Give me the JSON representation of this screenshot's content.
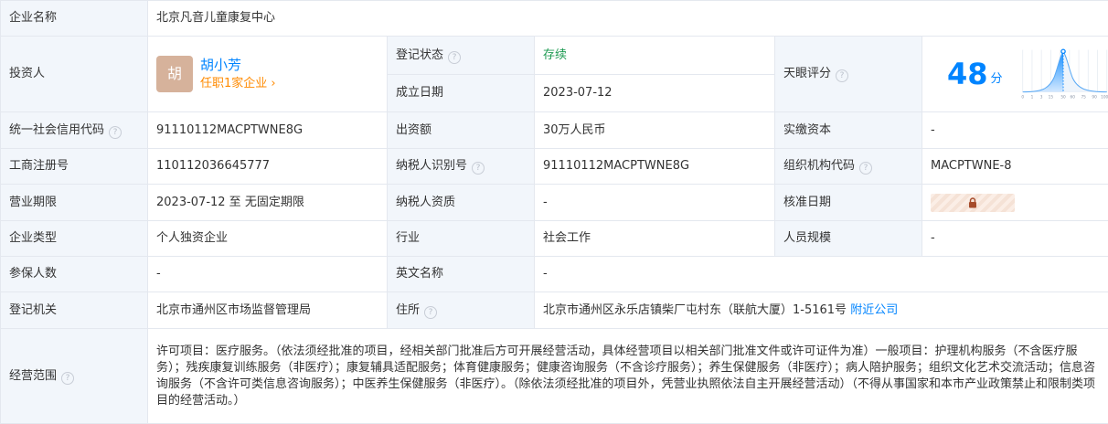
{
  "company_name": {
    "label": "企业名称",
    "value": "北京凡音儿童康复中心"
  },
  "investor": {
    "label": "投资人",
    "avatar_char": "胡",
    "name": "胡小芳",
    "role": "任职1家企业",
    "role_arrow": "›"
  },
  "reg_status": {
    "label": "登记状态",
    "value": "存续"
  },
  "found_date": {
    "label": "成立日期",
    "value": "2023-07-12"
  },
  "tianyan_score": {
    "label": "天眼评分",
    "score": "48",
    "unit": "分",
    "axis_ticks": [
      "0",
      "1",
      "3",
      "15",
      "50",
      "60",
      "75",
      "90",
      "100"
    ],
    "marker_value": 50
  },
  "credit_code": {
    "label": "统一社会信用代码",
    "value": "91110112MACPTWNE8G"
  },
  "capital": {
    "label": "出资额",
    "value": "30万人民币"
  },
  "paid_capital": {
    "label": "实缴资本",
    "value": "-"
  },
  "biz_reg_no": {
    "label": "工商注册号",
    "value": "110112036645777"
  },
  "taxpayer_id": {
    "label": "纳税人识别号",
    "value": "91110112MACPTWNE8G"
  },
  "org_code": {
    "label": "组织机构代码",
    "value": "MACPTWNE-8"
  },
  "biz_term": {
    "label": "营业期限",
    "value": "2023-07-12 至 无固定期限"
  },
  "taxpayer_qual": {
    "label": "纳税人资质",
    "value": "-"
  },
  "approve_date": {
    "label": "核准日期"
  },
  "company_type": {
    "label": "企业类型",
    "value": "个人独资企业"
  },
  "industry": {
    "label": "行业",
    "value": "社会工作"
  },
  "staff_size": {
    "label": "人员规模",
    "value": "-"
  },
  "insured": {
    "label": "参保人数",
    "value": "-"
  },
  "english_name": {
    "label": "英文名称",
    "value": "-"
  },
  "reg_authority": {
    "label": "登记机关",
    "value": "北京市通州区市场监督管理局"
  },
  "address": {
    "label": "住所",
    "value": "北京市通州区永乐店镇柴厂屯村东（联航大厦）1-5161号",
    "nearby": "附近公司"
  },
  "scope": {
    "label": "经营范围",
    "value": "许可项目：医疗服务。（依法须经批准的项目，经相关部门批准后方可开展经营活动，具体经营项目以相关部门批准文件或许可证件为准）一般项目：护理机构服务（不含医疗服务）；残疾康复训练服务（非医疗）；康复辅具适配服务；体育健康服务；健康咨询服务（不含诊疗服务）；养生保健服务（非医疗）；病人陪护服务；组织文化艺术交流活动；信息咨询服务（不含许可类信息咨询服务）；中医养生保健服务（非医疗）。（除依法须经批准的项目外，凭营业执照依法自主开展经营活动）（不得从事国家和本市产业政策禁止和限制类项目的经营活动。）"
  },
  "colors": {
    "label_bg": "#f2f6fb",
    "border": "#e4e8ef",
    "link": "#0084ff",
    "status_green": "#1f9b53",
    "accent_orange": "#ff8a00"
  },
  "icons": {
    "help": "question-circle-icon",
    "lock": "lock-icon"
  }
}
